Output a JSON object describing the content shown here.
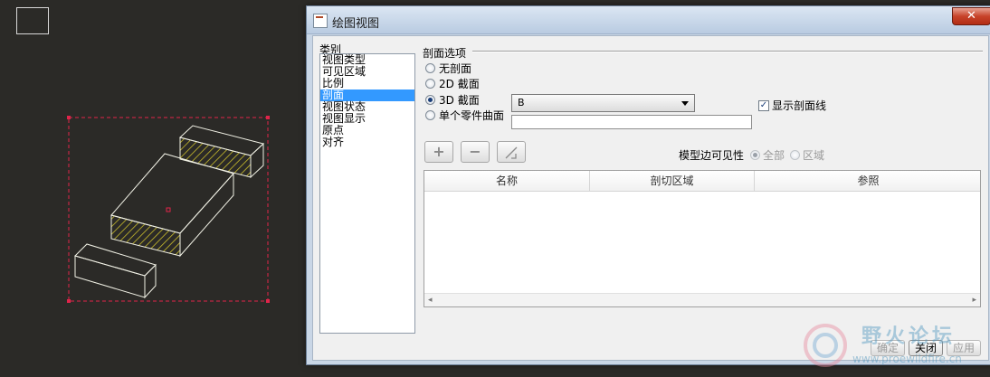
{
  "dialog": {
    "title": "绘图视图",
    "close_symbol": "✕"
  },
  "category": {
    "label": "类别",
    "items": [
      "视图类型",
      "可见区域",
      "比例",
      "剖面",
      "视图状态",
      "视图显示",
      "原点",
      "对齐"
    ],
    "selected": "剖面"
  },
  "section_options": {
    "label": "剖面选项",
    "no_section": "无剖面",
    "section_2d": "2D 截面",
    "section_3d": "3D 截面",
    "single_part_surface": "单个零件曲面",
    "selected": "3D 截面",
    "section_name_value": "B",
    "single_part_value": "",
    "show_hatch_label": "显示剖面线",
    "show_hatch_checked": true
  },
  "toolbar": {
    "add_symbol": "+",
    "remove_symbol": "−",
    "edit_icon": "arrow-edit-icon"
  },
  "model_edge_visibility": {
    "label": "模型边可见性",
    "all_label": "全部",
    "area_label": "区域",
    "selected": "全部"
  },
  "table": {
    "columns": [
      "名称",
      "剖切区域",
      "参照"
    ],
    "rows": []
  },
  "footer": {
    "ok_label": "确定",
    "close_label": "关闭",
    "apply_label": "应用"
  },
  "watermark": {
    "text": "野火论坛",
    "url": "www.proewildfire.cn"
  },
  "colors": {
    "accent_selection": "#3399ff",
    "sketch_lines": "#f2f2e6",
    "hatch": "#d6c82c",
    "outline_dashed": "#e0244a",
    "canvas_bg": "#2b2a27"
  }
}
